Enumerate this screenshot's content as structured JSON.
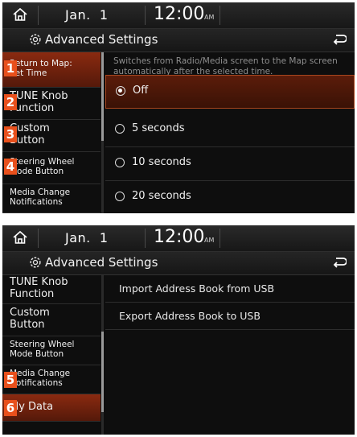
{
  "colors": {
    "accent": "#e8501c",
    "selected_bg": "#8a2a10",
    "screen_bg": "#0e0e0e"
  },
  "screen1": {
    "status": {
      "date": "Jan.  1",
      "time": "12:00",
      "ampm": "AM"
    },
    "title": "Advanced Settings",
    "sidebar": [
      {
        "label": "Return to Map:\nSet Time",
        "badge": "1",
        "selected": true
      },
      {
        "label": "TUNE Knob\nFunction",
        "badge": "2"
      },
      {
        "label": "Custom\nButton",
        "badge": "3"
      },
      {
        "label": "Steering Wheel\nMode Button",
        "badge": "4"
      },
      {
        "label": "Media Change\nNotifications"
      }
    ],
    "description": "Switches from Radio/Media screen to the Map screen automatically after the selected time.",
    "options": [
      {
        "label": "Off",
        "selected": true
      },
      {
        "label": "5 seconds"
      },
      {
        "label": "10 seconds"
      },
      {
        "label": "20 seconds"
      }
    ]
  },
  "screen2": {
    "status": {
      "date": "Jan.  1",
      "time": "12:00",
      "ampm": "AM"
    },
    "title": "Advanced Settings",
    "sidebar": [
      {
        "label": "TUNE Knob\nFunction"
      },
      {
        "label": "Custom\nButton"
      },
      {
        "label": "Steering Wheel\nMode Button"
      },
      {
        "label": "Media Change\nNotifications",
        "badge": "5"
      },
      {
        "label": "My Data",
        "badge": "6",
        "selected": true
      }
    ],
    "items": [
      {
        "label": "Import Address Book from USB"
      },
      {
        "label": "Export Address Book to USB"
      }
    ]
  }
}
